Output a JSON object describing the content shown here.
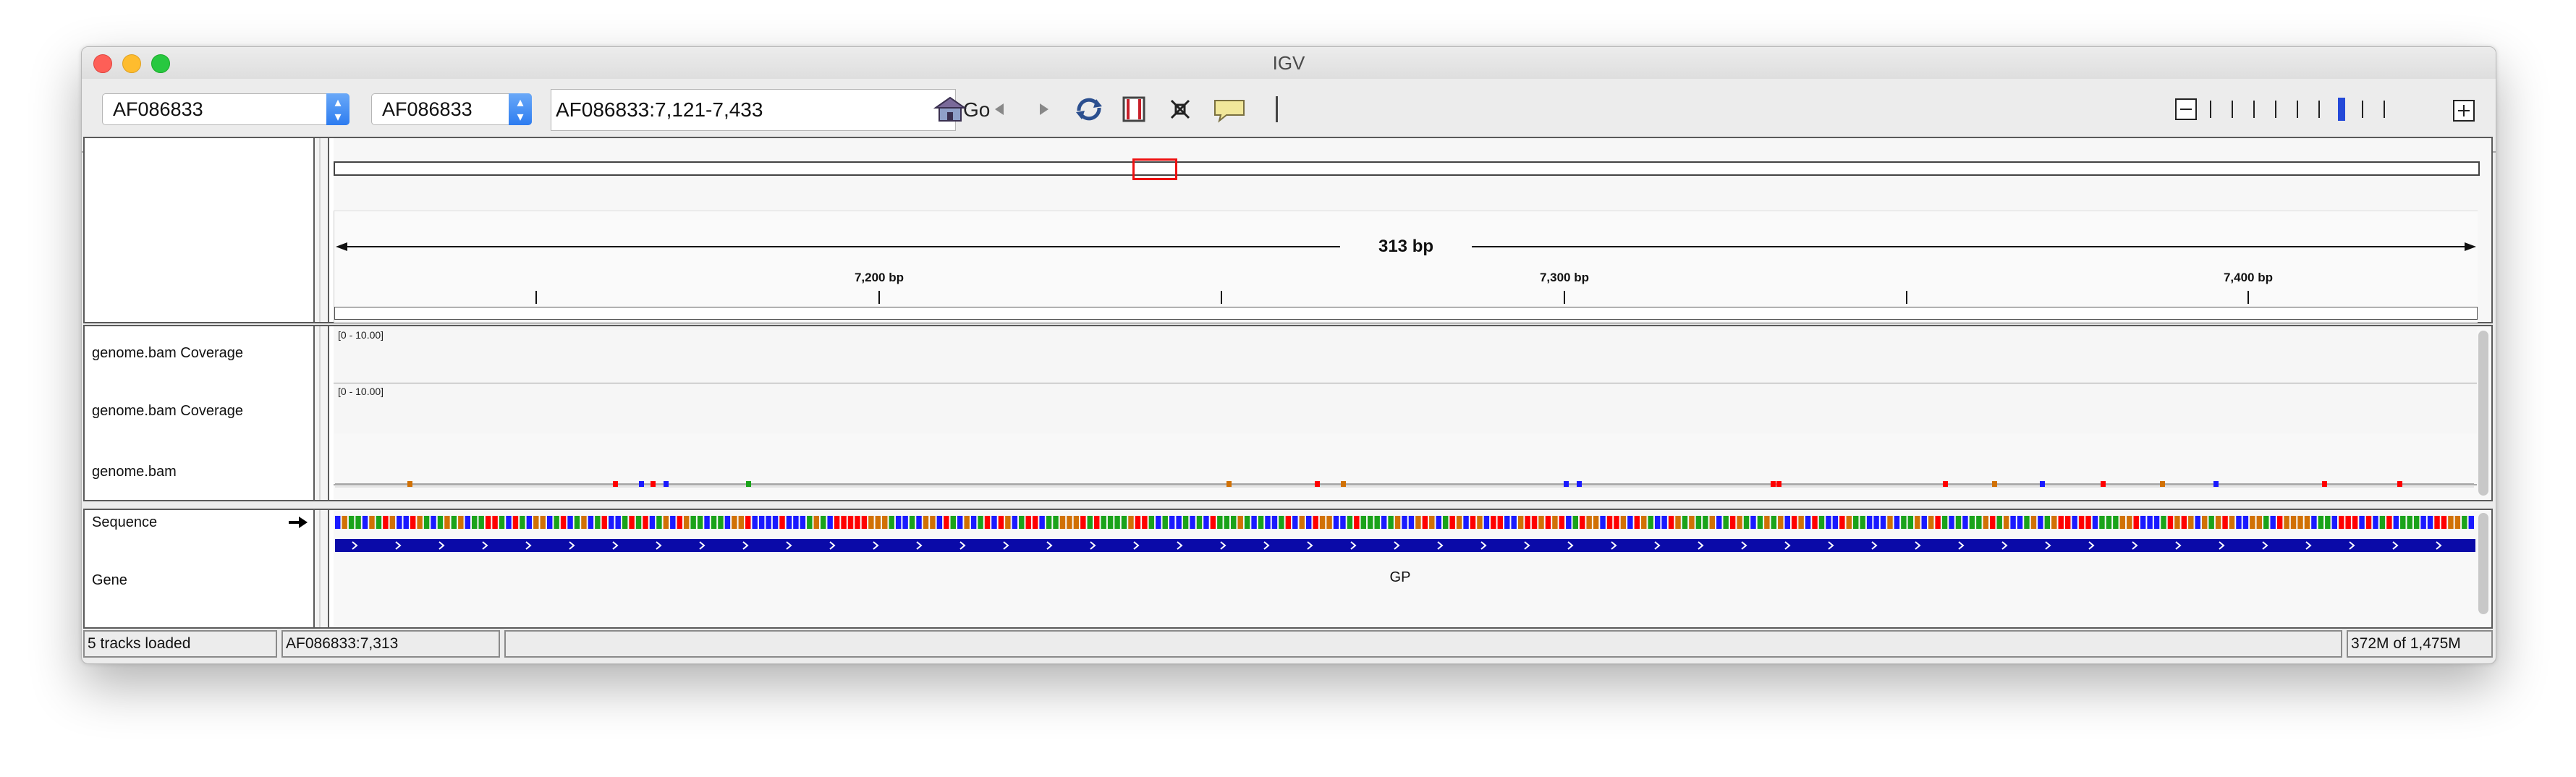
{
  "window": {
    "title": "IGV"
  },
  "toolbar": {
    "genome_select": "AF086833",
    "chrom_select": "AF086833",
    "locus_value": "AF086833:7,121-7,433",
    "go_label": "Go",
    "icons": [
      "home-icon",
      "back-icon",
      "forward-icon",
      "refresh-icon",
      "roi-icon",
      "resize-icon",
      "popup-info-icon"
    ]
  },
  "ruler": {
    "span_label": "313 bp",
    "ticks": [
      "7,200 bp",
      "7,300 bp",
      "7,400 bp"
    ]
  },
  "tracks": {
    "coverage_1_name": "genome.bam Coverage",
    "coverage_1_range": "[0 - 10.00]",
    "coverage_2_name": "genome.bam Coverage",
    "coverage_2_range": "[0 - 10.00]",
    "bam_name": "genome.bam",
    "sequence_name": "Sequence",
    "gene_name": "Gene",
    "gene_label": "GP"
  },
  "statusbar": {
    "tracks_loaded": "5 tracks loaded",
    "position": "AF086833:7,313",
    "memory": "372M of 1,475M"
  },
  "colors": {
    "alignment": "#e8a0a0",
    "gene": "#0a0aa8",
    "mismatch_A": "#1aa31a",
    "mismatch_C": "#1a1aff",
    "mismatch_G": "#d17105",
    "mismatch_T": "#ff0000"
  }
}
